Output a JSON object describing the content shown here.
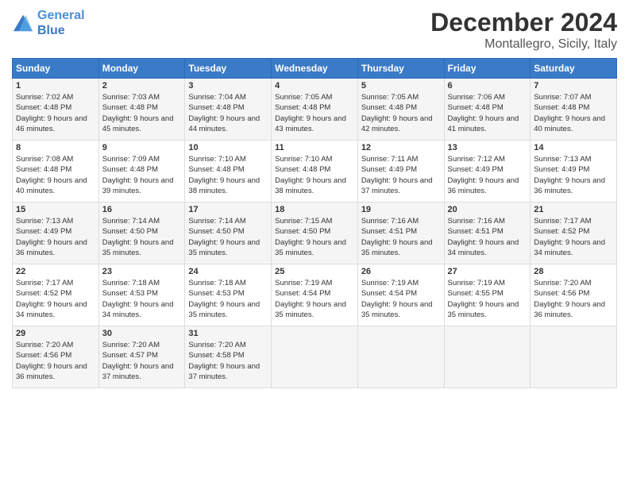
{
  "logo": {
    "line1": "General",
    "line2": "Blue"
  },
  "title": "December 2024",
  "location": "Montallegro, Sicily, Italy",
  "days_of_week": [
    "Sunday",
    "Monday",
    "Tuesday",
    "Wednesday",
    "Thursday",
    "Friday",
    "Saturday"
  ],
  "weeks": [
    [
      {
        "day": "1",
        "sunrise": "7:02 AM",
        "sunset": "4:48 PM",
        "daylight": "9 hours and 46 minutes."
      },
      {
        "day": "2",
        "sunrise": "7:03 AM",
        "sunset": "4:48 PM",
        "daylight": "9 hours and 45 minutes."
      },
      {
        "day": "3",
        "sunrise": "7:04 AM",
        "sunset": "4:48 PM",
        "daylight": "9 hours and 44 minutes."
      },
      {
        "day": "4",
        "sunrise": "7:05 AM",
        "sunset": "4:48 PM",
        "daylight": "9 hours and 43 minutes."
      },
      {
        "day": "5",
        "sunrise": "7:05 AM",
        "sunset": "4:48 PM",
        "daylight": "9 hours and 42 minutes."
      },
      {
        "day": "6",
        "sunrise": "7:06 AM",
        "sunset": "4:48 PM",
        "daylight": "9 hours and 41 minutes."
      },
      {
        "day": "7",
        "sunrise": "7:07 AM",
        "sunset": "4:48 PM",
        "daylight": "9 hours and 40 minutes."
      }
    ],
    [
      {
        "day": "8",
        "sunrise": "7:08 AM",
        "sunset": "4:48 PM",
        "daylight": "9 hours and 40 minutes."
      },
      {
        "day": "9",
        "sunrise": "7:09 AM",
        "sunset": "4:48 PM",
        "daylight": "9 hours and 39 minutes."
      },
      {
        "day": "10",
        "sunrise": "7:10 AM",
        "sunset": "4:48 PM",
        "daylight": "9 hours and 38 minutes."
      },
      {
        "day": "11",
        "sunrise": "7:10 AM",
        "sunset": "4:48 PM",
        "daylight": "9 hours and 38 minutes."
      },
      {
        "day": "12",
        "sunrise": "7:11 AM",
        "sunset": "4:49 PM",
        "daylight": "9 hours and 37 minutes."
      },
      {
        "day": "13",
        "sunrise": "7:12 AM",
        "sunset": "4:49 PM",
        "daylight": "9 hours and 36 minutes."
      },
      {
        "day": "14",
        "sunrise": "7:13 AM",
        "sunset": "4:49 PM",
        "daylight": "9 hours and 36 minutes."
      }
    ],
    [
      {
        "day": "15",
        "sunrise": "7:13 AM",
        "sunset": "4:49 PM",
        "daylight": "9 hours and 36 minutes."
      },
      {
        "day": "16",
        "sunrise": "7:14 AM",
        "sunset": "4:50 PM",
        "daylight": "9 hours and 35 minutes."
      },
      {
        "day": "17",
        "sunrise": "7:14 AM",
        "sunset": "4:50 PM",
        "daylight": "9 hours and 35 minutes."
      },
      {
        "day": "18",
        "sunrise": "7:15 AM",
        "sunset": "4:50 PM",
        "daylight": "9 hours and 35 minutes."
      },
      {
        "day": "19",
        "sunrise": "7:16 AM",
        "sunset": "4:51 PM",
        "daylight": "9 hours and 35 minutes."
      },
      {
        "day": "20",
        "sunrise": "7:16 AM",
        "sunset": "4:51 PM",
        "daylight": "9 hours and 34 minutes."
      },
      {
        "day": "21",
        "sunrise": "7:17 AM",
        "sunset": "4:52 PM",
        "daylight": "9 hours and 34 minutes."
      }
    ],
    [
      {
        "day": "22",
        "sunrise": "7:17 AM",
        "sunset": "4:52 PM",
        "daylight": "9 hours and 34 minutes."
      },
      {
        "day": "23",
        "sunrise": "7:18 AM",
        "sunset": "4:53 PM",
        "daylight": "9 hours and 34 minutes."
      },
      {
        "day": "24",
        "sunrise": "7:18 AM",
        "sunset": "4:53 PM",
        "daylight": "9 hours and 35 minutes."
      },
      {
        "day": "25",
        "sunrise": "7:19 AM",
        "sunset": "4:54 PM",
        "daylight": "9 hours and 35 minutes."
      },
      {
        "day": "26",
        "sunrise": "7:19 AM",
        "sunset": "4:54 PM",
        "daylight": "9 hours and 35 minutes."
      },
      {
        "day": "27",
        "sunrise": "7:19 AM",
        "sunset": "4:55 PM",
        "daylight": "9 hours and 35 minutes."
      },
      {
        "day": "28",
        "sunrise": "7:20 AM",
        "sunset": "4:56 PM",
        "daylight": "9 hours and 36 minutes."
      }
    ],
    [
      {
        "day": "29",
        "sunrise": "7:20 AM",
        "sunset": "4:56 PM",
        "daylight": "9 hours and 36 minutes."
      },
      {
        "day": "30",
        "sunrise": "7:20 AM",
        "sunset": "4:57 PM",
        "daylight": "9 hours and 37 minutes."
      },
      {
        "day": "31",
        "sunrise": "7:20 AM",
        "sunset": "4:58 PM",
        "daylight": "9 hours and 37 minutes."
      },
      null,
      null,
      null,
      null
    ]
  ]
}
